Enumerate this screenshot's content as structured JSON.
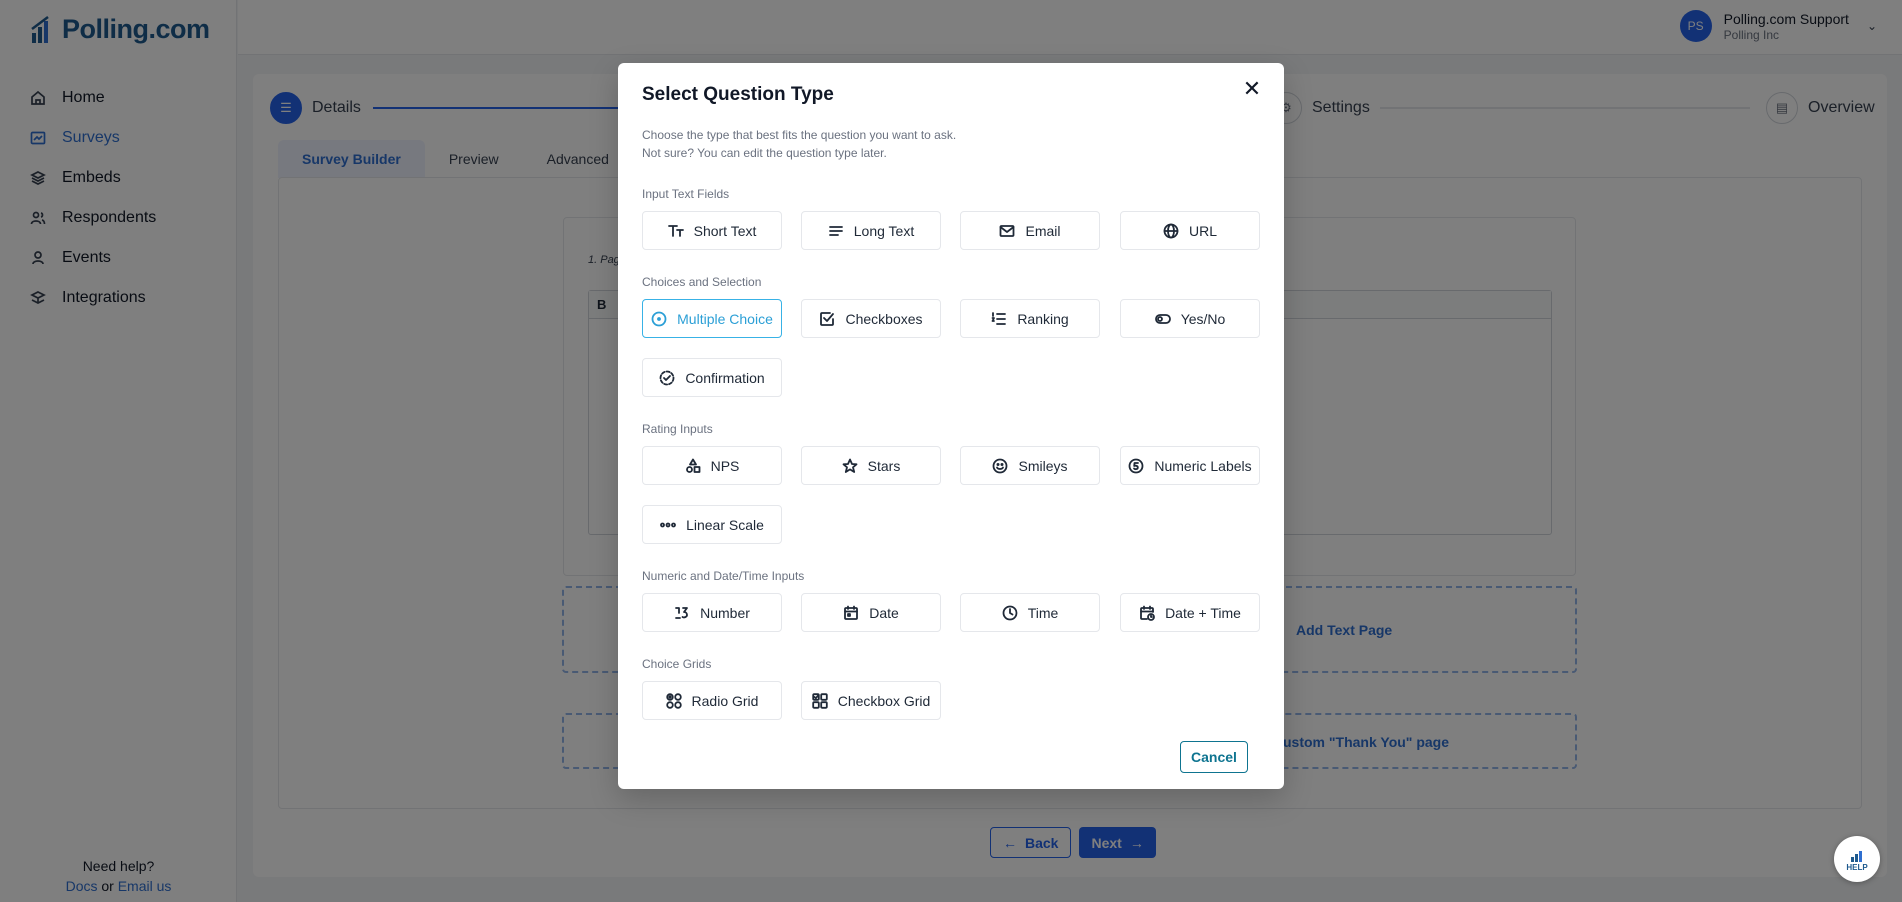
{
  "app": {
    "logo": "Polling.com"
  },
  "sidebar": {
    "items": [
      {
        "label": "Home",
        "icon": "home-icon"
      },
      {
        "label": "Surveys",
        "icon": "surveys-icon"
      },
      {
        "label": "Embeds",
        "icon": "layers-icon"
      },
      {
        "label": "Respondents",
        "icon": "users-icon"
      },
      {
        "label": "Events",
        "icon": "events-icon"
      },
      {
        "label": "Integrations",
        "icon": "integrations-icon"
      }
    ],
    "help_title": "Need help?",
    "docs_link": "Docs",
    "or_text": "or",
    "email_link": "Email us"
  },
  "user": {
    "initials": "PS",
    "name": "Polling.com Support",
    "org": "Polling Inc"
  },
  "stepper": {
    "step1": "Details",
    "step3": "Settings",
    "step4": "Overview"
  },
  "tabs": [
    "Survey Builder",
    "Preview",
    "Advanced"
  ],
  "background": {
    "question_prefix": "1. Pag",
    "bold_btn": "B",
    "add_text_page": "Add Text Page",
    "thank_you": "ustom \"Thank You\" page",
    "back": "Back",
    "next": "Next"
  },
  "help_fab": "HELP",
  "modal": {
    "title": "Select Question Type",
    "desc_line1": "Choose the type that best fits the question you want to ask.",
    "desc_line2": "Not sure? You can edit the question type later.",
    "sections": {
      "input_text": {
        "label": "Input Text Fields",
        "options": [
          "Short Text",
          "Long Text",
          "Email",
          "URL"
        ]
      },
      "choices": {
        "label": "Choices and Selection",
        "options": [
          "Multiple Choice",
          "Checkboxes",
          "Ranking",
          "Yes/No",
          "Confirmation"
        ]
      },
      "rating": {
        "label": "Rating Inputs",
        "options": [
          "NPS",
          "Stars",
          "Smileys",
          "Numeric Labels",
          "Linear Scale"
        ]
      },
      "numeric": {
        "label": "Numeric and Date/Time Inputs",
        "options": [
          "Number",
          "Date",
          "Time",
          "Date + Time"
        ]
      },
      "grids": {
        "label": "Choice Grids",
        "options": [
          "Radio Grid",
          "Checkbox Grid"
        ]
      }
    },
    "selected": "Multiple Choice",
    "cancel": "Cancel"
  },
  "colors": {
    "accent": "#2563eb",
    "selected": "#38b2e6",
    "cancel": "#0e7490"
  }
}
